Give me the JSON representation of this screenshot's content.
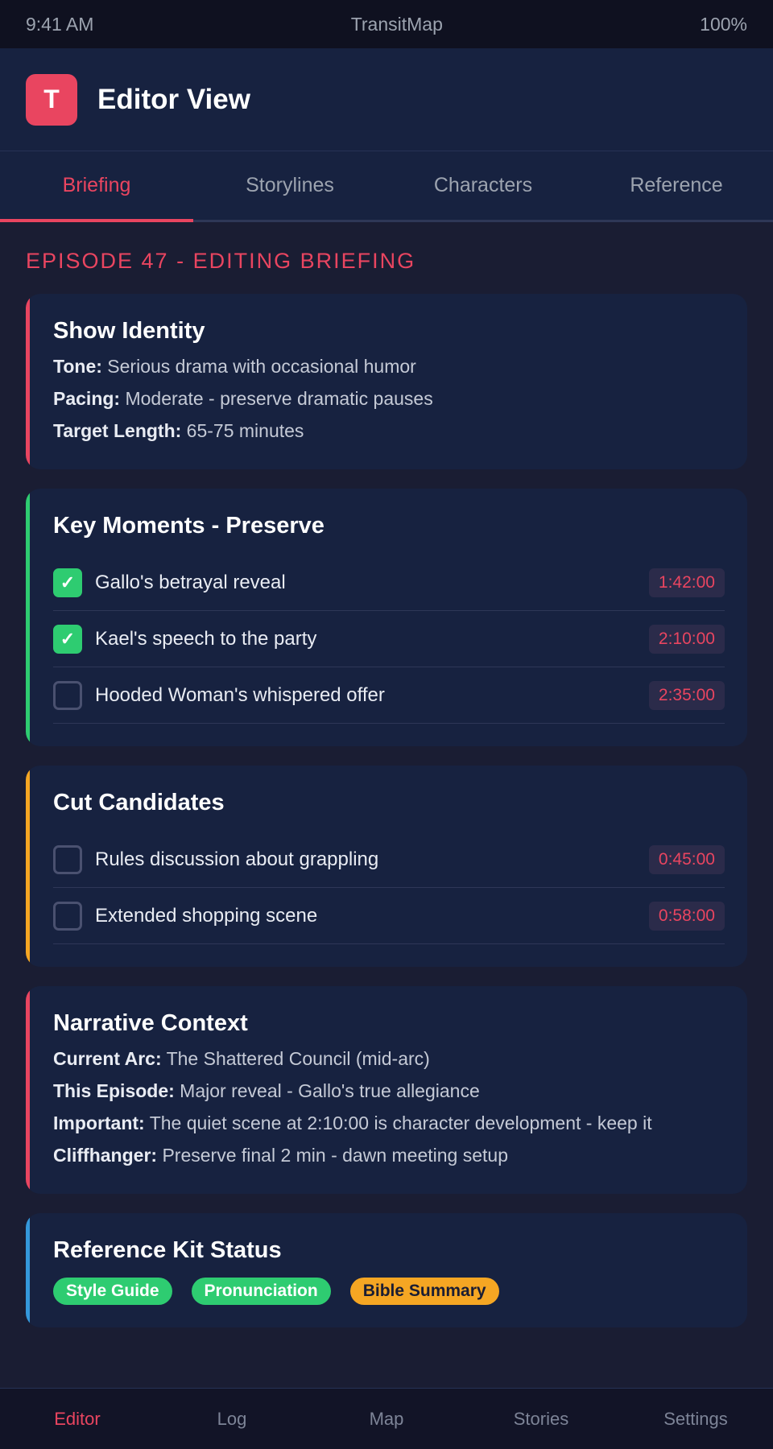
{
  "status_bar": {
    "time": "9:41 AM",
    "app_name": "TransitMap",
    "battery": "100%"
  },
  "header": {
    "icon_letter": "T",
    "title": "Editor View"
  },
  "tabs": [
    {
      "label": "Briefing",
      "active": true
    },
    {
      "label": "Storylines",
      "active": false
    },
    {
      "label": "Characters",
      "active": false
    },
    {
      "label": "Reference",
      "active": false
    }
  ],
  "section_heading": "EPISODE 47 - EDITING BRIEFING",
  "show_identity": {
    "title": "Show Identity",
    "accent": "#e94560",
    "rows": [
      {
        "key": "Tone:",
        "value": " Serious drama with occasional humor"
      },
      {
        "key": "Pacing:",
        "value": " Moderate - preserve dramatic pauses"
      },
      {
        "key": "Target Length:",
        "value": " 65-75 minutes"
      }
    ]
  },
  "key_moments": {
    "title": "Key Moments - Preserve",
    "accent": "#2ecc71",
    "items": [
      {
        "label": "Gallo's betrayal reveal",
        "time": "1:42:00",
        "checked": true,
        "check_glyph": "✓"
      },
      {
        "label": "Kael's speech to the party",
        "time": "2:10:00",
        "checked": true,
        "check_glyph": "✓"
      },
      {
        "label": "Hooded Woman's whispered offer",
        "time": "2:35:00",
        "checked": false,
        "check_glyph": ""
      }
    ]
  },
  "cut_candidates": {
    "title": "Cut Candidates",
    "accent": "#f5a623",
    "items": [
      {
        "label": "Rules discussion about grappling",
        "time": "0:45:00",
        "checked": false
      },
      {
        "label": "Extended shopping scene",
        "time": "0:58:00",
        "checked": false
      }
    ]
  },
  "narrative_context": {
    "title": "Narrative Context",
    "accent": "#e94560",
    "rows": [
      {
        "key": "Current Arc:",
        "value": " The Shattered Council (mid-arc)"
      },
      {
        "key": "This Episode:",
        "value": " Major reveal - Gallo's true allegiance"
      },
      {
        "key": "Important:",
        "value": " The quiet scene at 2:10:00 is character development - keep it"
      },
      {
        "key": "Cliffhanger:",
        "value": " Preserve final 2 min - dawn meeting setup"
      }
    ]
  },
  "reference_kit": {
    "title": "Reference Kit Status",
    "accent": "#3498db",
    "pills": [
      {
        "label": "Style Guide",
        "color": "#2ecc71",
        "text_color": "#ffffff"
      },
      {
        "label": "Pronunciation",
        "color": "#2ecc71",
        "text_color": "#ffffff"
      },
      {
        "label": "Bible Summary",
        "color": "#f5a623",
        "text_color": "#1a1d33"
      }
    ]
  },
  "bottom_nav": [
    {
      "label": "Editor",
      "active": true
    },
    {
      "label": "Log",
      "active": false
    },
    {
      "label": "Map",
      "active": false
    },
    {
      "label": "Stories",
      "active": false
    },
    {
      "label": "Settings",
      "active": false
    }
  ]
}
